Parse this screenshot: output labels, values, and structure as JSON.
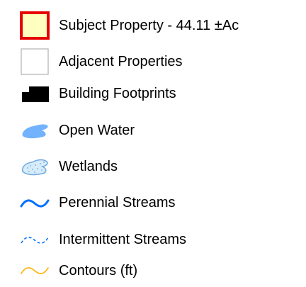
{
  "legend": {
    "items": [
      {
        "label": "Subject Property - 44.11 ±Ac",
        "icon": "subject-property-swatch-icon",
        "fill": "#FFFFC0",
        "stroke": "#E60000"
      },
      {
        "label": "Adjacent Properties",
        "icon": "adjacent-properties-swatch-icon",
        "fill": "#FFFFFF",
        "stroke": "#B0B0B0"
      },
      {
        "label": "Building Footprints",
        "icon": "building-footprints-icon",
        "fill": "#000000"
      },
      {
        "label": "Open Water",
        "icon": "open-water-icon",
        "fill": "#73B2FF"
      },
      {
        "label": "Wetlands",
        "icon": "wetlands-icon",
        "fill": "#D6ECFA",
        "stroke": "#6FA8DC"
      },
      {
        "label": "Perennial Streams",
        "icon": "perennial-stream-line-icon",
        "stroke": "#0070FF"
      },
      {
        "label": "Intermittent Streams",
        "icon": "intermittent-stream-line-icon",
        "stroke": "#0070FF"
      },
      {
        "label": "Contours (ft)",
        "icon": "contour-line-icon",
        "stroke": "#FFB000"
      }
    ]
  }
}
